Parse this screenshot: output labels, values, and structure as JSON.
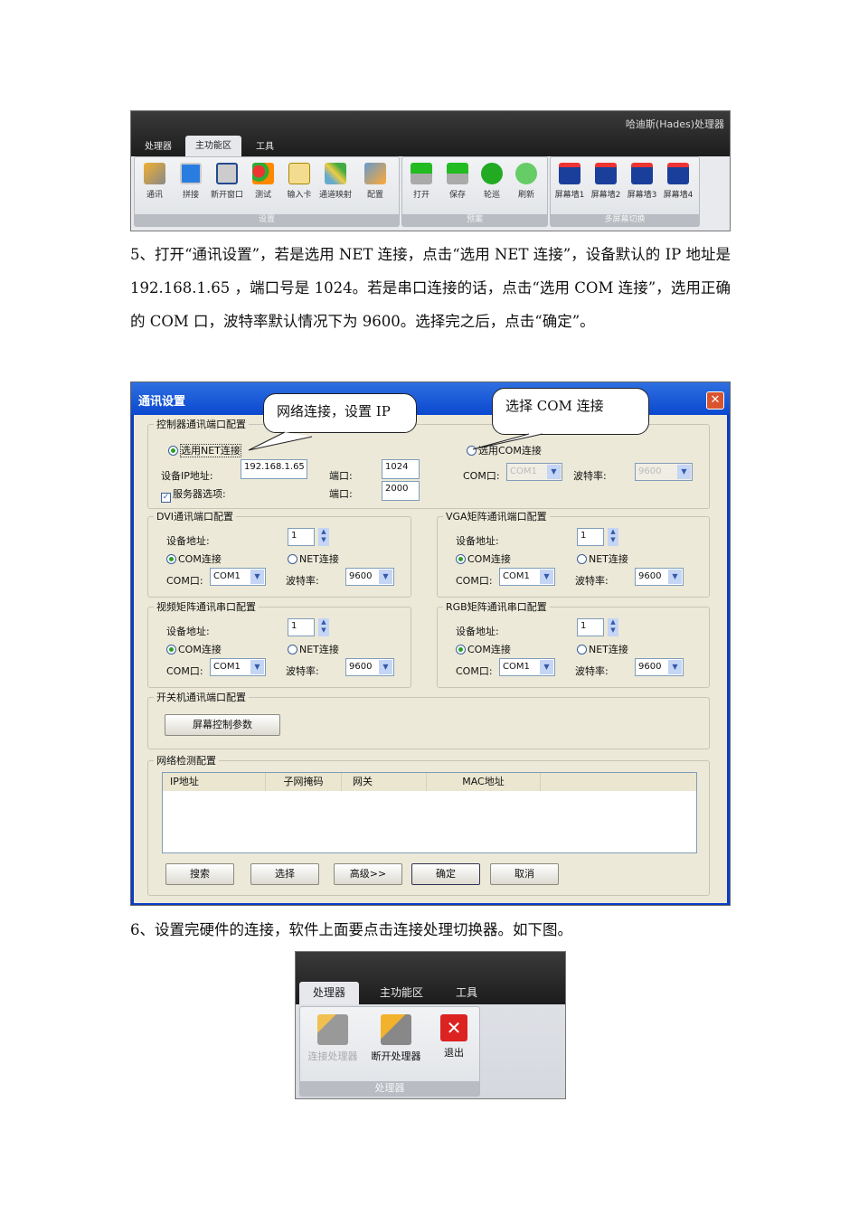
{
  "ribbon1": {
    "app_title": "哈迪斯(Hades)处理器",
    "tabs": [
      "处理器",
      "主功能区",
      "工具"
    ],
    "groups": [
      {
        "caption": "设置",
        "tools": [
          "通讯",
          "拼接",
          "新开窗口",
          "测试",
          "输入卡",
          "通道映射",
          "配置"
        ]
      },
      {
        "caption": "预案",
        "tools": [
          "打开",
          "保存",
          "轮巡",
          "刷新"
        ]
      },
      {
        "caption": "多屏幕切换",
        "tools": [
          "屏幕墙1",
          "屏幕墙2",
          "屏幕墙3",
          "屏幕墙4"
        ]
      }
    ]
  },
  "paragraph5": "5、打开“通讯设置”，若是选用 NET 连接，点击“选用 NET 连接”，设备默认的 IP 地址是 192.168.1.65 ，端口号是 1024。若是串口连接的话，点击“选用 COM 连接”，选用正确的 COM 口，波特率默认情况下为 9600。选择完之后，点击“确定”。",
  "dialog": {
    "title": "通讯设置",
    "callout_net": "网络连接，设置 IP",
    "callout_com": "选择 COM 连接",
    "controller": {
      "legend": "控制器通讯端口配置",
      "net_radio": "选用NET连接",
      "com_radio": "选用COM连接",
      "ip_label": "设备IP地址:",
      "ip_value": "192.168.1.65",
      "port_label": "端口:",
      "port_value": "1024",
      "server_label": "服务器选项:",
      "server_port_label": "端口:",
      "server_port_value": "2000",
      "com_label": "COM口:",
      "com_value": "COM1",
      "baud_label": "波特率:",
      "baud_value": "9600"
    },
    "panels": [
      {
        "legend": "DVI通讯端口配置",
        "addr_label": "设备地址:",
        "addr": "1",
        "com_radio": "COM连接",
        "net_radio": "NET连接",
        "com_label": "COM口:",
        "com": "COM1",
        "baud_label": "波特率:",
        "baud": "9600"
      },
      {
        "legend": "VGA矩阵通讯端口配置",
        "addr_label": "设备地址:",
        "addr": "1",
        "com_radio": "COM连接",
        "net_radio": "NET连接",
        "com_label": "COM口:",
        "com": "COM1",
        "baud_label": "波特率:",
        "baud": "9600"
      },
      {
        "legend": "视频矩阵通讯串口配置",
        "addr_label": "设备地址:",
        "addr": "1",
        "com_radio": "COM连接",
        "net_radio": "NET连接",
        "com_label": "COM口:",
        "com": "COM1",
        "baud_label": "波特率:",
        "baud": "9600"
      },
      {
        "legend": "RGB矩阵通讯串口配置",
        "addr_label": "设备地址:",
        "addr": "1",
        "com_radio": "COM连接",
        "net_radio": "NET连接",
        "com_label": "COM口:",
        "com": "COM1",
        "baud_label": "波特率:",
        "baud": "9600"
      }
    ],
    "power": {
      "legend": "开关机通讯端口配置",
      "button": "屏幕控制参数"
    },
    "network": {
      "legend": "网络检测配置",
      "columns": [
        "IP地址",
        "子网掩码",
        "网关",
        "MAC地址"
      ]
    },
    "buttons": [
      "搜索",
      "选择",
      "高级>>",
      "确定",
      "取消"
    ]
  },
  "paragraph6": "6、设置完硬件的连接，软件上面要点击连接处理切换器。如下图。",
  "ribbon2": {
    "tabs": [
      "处理器",
      "主功能区",
      "工具"
    ],
    "tools": [
      "连接处理器",
      "断开处理器",
      "退出"
    ],
    "caption": "处理器"
  }
}
